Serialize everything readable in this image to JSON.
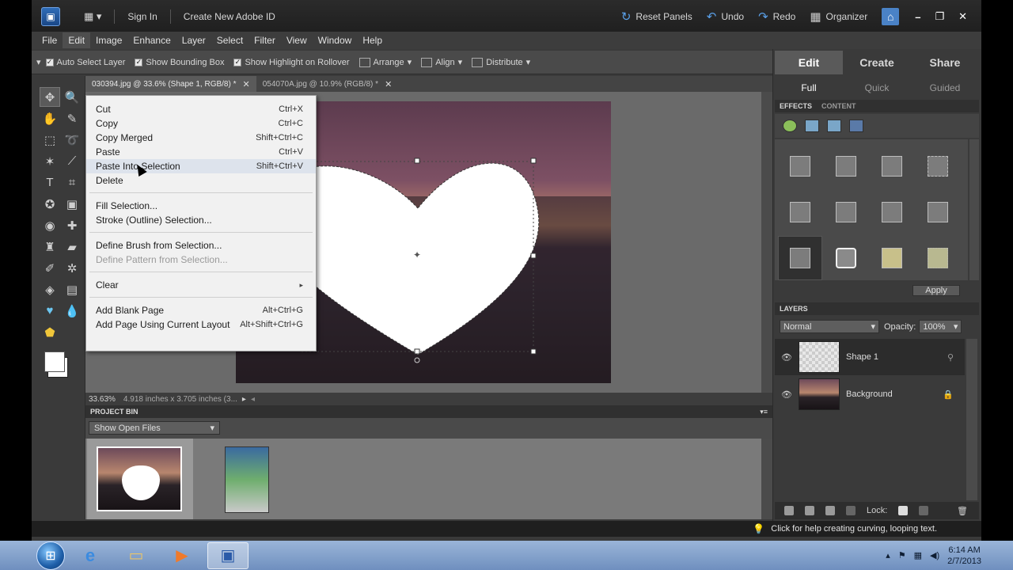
{
  "titlebar": {
    "sign_in": "Sign In",
    "create_id": "Create New Adobe ID",
    "reset_panels": "Reset Panels",
    "undo": "Undo",
    "redo": "Redo",
    "organizer": "Organizer"
  },
  "menubar": [
    "File",
    "Edit",
    "Image",
    "Enhance",
    "Layer",
    "Select",
    "Filter",
    "View",
    "Window",
    "Help"
  ],
  "options": {
    "auto_select": "Auto Select Layer",
    "bounding_box": "Show Bounding Box",
    "highlight": "Show Highlight on Rollover",
    "arrange": "Arrange",
    "align": "Align",
    "distribute": "Distribute"
  },
  "tabs": [
    {
      "label": "030394.jpg @ 33.6% (Shape 1, RGB/8) *"
    },
    {
      "label": "054070A.jpg @ 10.9% (RGB/8) *"
    }
  ],
  "context_menu": {
    "items": [
      {
        "label": "Cut",
        "shortcut": "Ctrl+X"
      },
      {
        "label": "Copy",
        "shortcut": "Ctrl+C"
      },
      {
        "label": "Copy Merged",
        "shortcut": "Shift+Ctrl+C"
      },
      {
        "label": "Paste",
        "shortcut": "Ctrl+V"
      },
      {
        "label": "Paste Into Selection",
        "shortcut": "Shift+Ctrl+V"
      },
      {
        "label": "Delete",
        "shortcut": ""
      },
      {
        "label": "Fill Selection...",
        "shortcut": ""
      },
      {
        "label": "Stroke (Outline) Selection...",
        "shortcut": ""
      },
      {
        "label": "Define Brush from Selection...",
        "shortcut": ""
      },
      {
        "label": "Define Pattern from Selection...",
        "shortcut": ""
      },
      {
        "label": "Clear",
        "shortcut": ""
      },
      {
        "label": "Add Blank Page",
        "shortcut": "Alt+Ctrl+G"
      },
      {
        "label": "Add Page Using Current Layout",
        "shortcut": "Alt+Shift+Ctrl+G"
      }
    ]
  },
  "status": {
    "zoom": "33.63%",
    "dims": "4.918 inches x 3.705 inches (3..."
  },
  "project_bin": {
    "title": "PROJECT BIN",
    "show": "Show Open Files"
  },
  "right_panel": {
    "modes": [
      "Edit",
      "Create",
      "Share"
    ],
    "subs": [
      "Full",
      "Quick",
      "Guided"
    ],
    "effects": "EFFECTS",
    "content": "CONTENT",
    "apply": "Apply",
    "layers": "LAYERS",
    "blend_mode": "Normal",
    "opacity_label": "Opacity:",
    "opacity_value": "100%",
    "layer_list": [
      {
        "name": "Shape 1"
      },
      {
        "name": "Background"
      }
    ],
    "lock_label": "Lock:"
  },
  "help_text": "Click for help creating curving, looping text.",
  "clock": {
    "time": "6:14 AM",
    "date": "2/7/2013"
  }
}
